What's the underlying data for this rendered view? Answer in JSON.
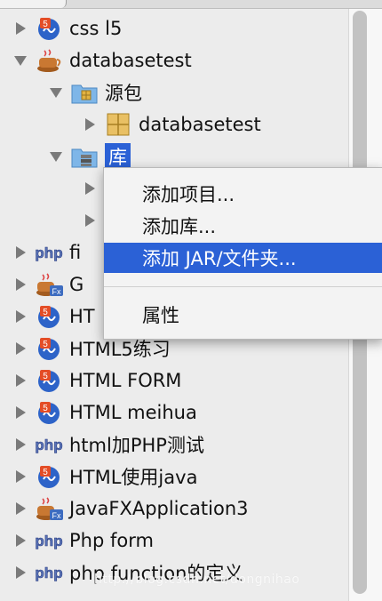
{
  "tree": {
    "rows": [
      {
        "label": "css l5"
      },
      {
        "label": "databasetest"
      },
      {
        "label": "源包"
      },
      {
        "label": "databasetest"
      },
      {
        "label": "库"
      },
      {
        "label": ""
      },
      {
        "label": ""
      },
      {
        "label": "fi"
      },
      {
        "label": "G"
      },
      {
        "label": "HT"
      },
      {
        "label": "HTML5练习"
      },
      {
        "label": "HTML FORM"
      },
      {
        "label": "HTML meihua"
      },
      {
        "label": "html加PHP测试"
      },
      {
        "label": "HTML使用java"
      },
      {
        "label": "JavaFXApplication3"
      },
      {
        "label": "Php form"
      },
      {
        "label": "php function的定义"
      }
    ]
  },
  "context_menu": {
    "items": [
      {
        "label": "添加项目..."
      },
      {
        "label": "添加库..."
      },
      {
        "label": "添加 JAR/文件夹..."
      },
      {
        "label": "属性"
      }
    ]
  },
  "watermark": {
    "text": "http://blog.csdn.net/dongnihao"
  },
  "colors": {
    "selection": "#2b61d6",
    "background": "#ececec"
  }
}
